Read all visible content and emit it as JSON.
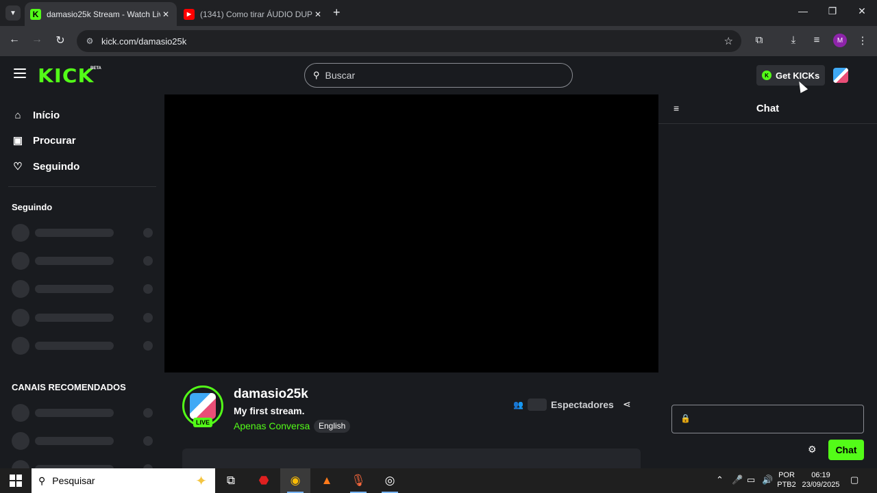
{
  "browser": {
    "tabs": [
      {
        "title": "damasio25k Stream - Watch Liv",
        "active": true,
        "favicon": "kick-favicon"
      },
      {
        "title": "(1341) Como tirar ÁUDIO DUPLI",
        "active": false,
        "favicon": "youtube-favicon"
      }
    ],
    "url": "kick.com/damasio25k",
    "profile_initial": "M"
  },
  "kick": {
    "logo": "KICK",
    "logo_badge": "BETA",
    "search_placeholder": "Buscar",
    "get_kicks_label": "Get KICKs",
    "nav": [
      {
        "label": "Início",
        "icon": "home-icon"
      },
      {
        "label": "Procurar",
        "icon": "browse-icon"
      },
      {
        "label": "Seguindo",
        "icon": "heart-icon"
      }
    ],
    "following_heading": "Seguindo",
    "recommended_heading": "CANAIS RECOMENDADOS"
  },
  "channel": {
    "name": "damasio25k",
    "stream_title": "My first stream.",
    "category": "Apenas Conversa",
    "language": "English",
    "live_badge": "LIVE",
    "viewers_label": "Espectadores"
  },
  "chat": {
    "title": "Chat",
    "send_label": "Chat"
  },
  "taskbar": {
    "search_label": "Pesquisar",
    "language_primary": "POR",
    "language_secondary": "PTB2",
    "time": "06:19",
    "date": "23/09/2025"
  },
  "colors": {
    "brand_green": "#53fc18",
    "background": "#191b1f",
    "surface": "#2f3136"
  }
}
